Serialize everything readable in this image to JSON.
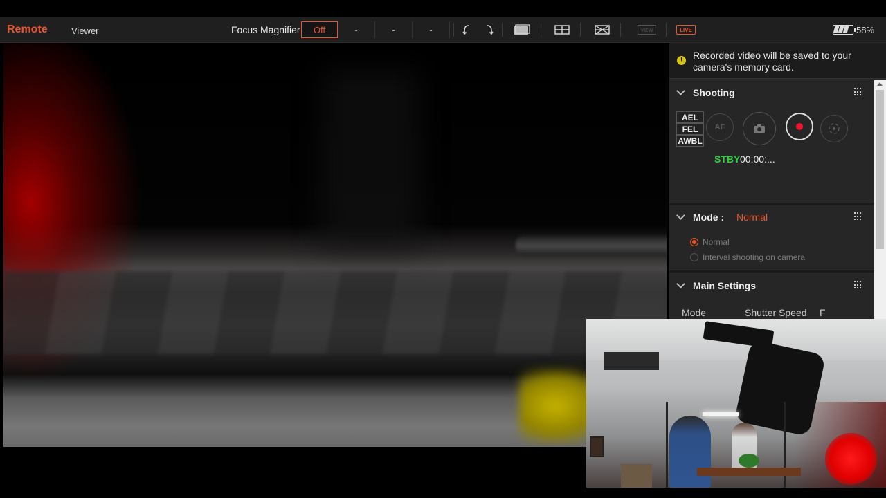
{
  "app": {
    "brand": "Remote",
    "tab_viewer": "Viewer"
  },
  "toolbar": {
    "focus_magnifier_label": "Focus Magnifier",
    "focus_magnifier_options": [
      "Off",
      "-",
      "-",
      "-"
    ],
    "icons": [
      "rotate-left-icon",
      "rotate-right-icon",
      "overlay-display-icon",
      "grid-lines-icon",
      "guide-frame-icon",
      "view-mode-icon"
    ],
    "live_badge": "LIVE",
    "battery_percent": "58%",
    "battery_level": 0.58
  },
  "panel": {
    "notice": "Recorded video will be saved to your camera's memory card.",
    "shooting": {
      "title": "Shooting",
      "lock_buttons": [
        "AEL",
        "FEL",
        "AWBL"
      ],
      "af_label": "AF",
      "status": "STBY",
      "timecode": "00:00:..."
    },
    "mode": {
      "title": "Mode :",
      "value": "Normal",
      "options": [
        {
          "label": "Normal",
          "selected": true
        },
        {
          "label": "Interval shooting on camera",
          "selected": false
        }
      ]
    },
    "main_settings": {
      "title": "Main Settings",
      "labels": [
        "Mode",
        "Shutter Speed",
        "F"
      ]
    }
  },
  "colors": {
    "accent": "#e8542c",
    "standby": "#26d33a",
    "record": "#e8182c",
    "warning": "#d8c31a"
  }
}
